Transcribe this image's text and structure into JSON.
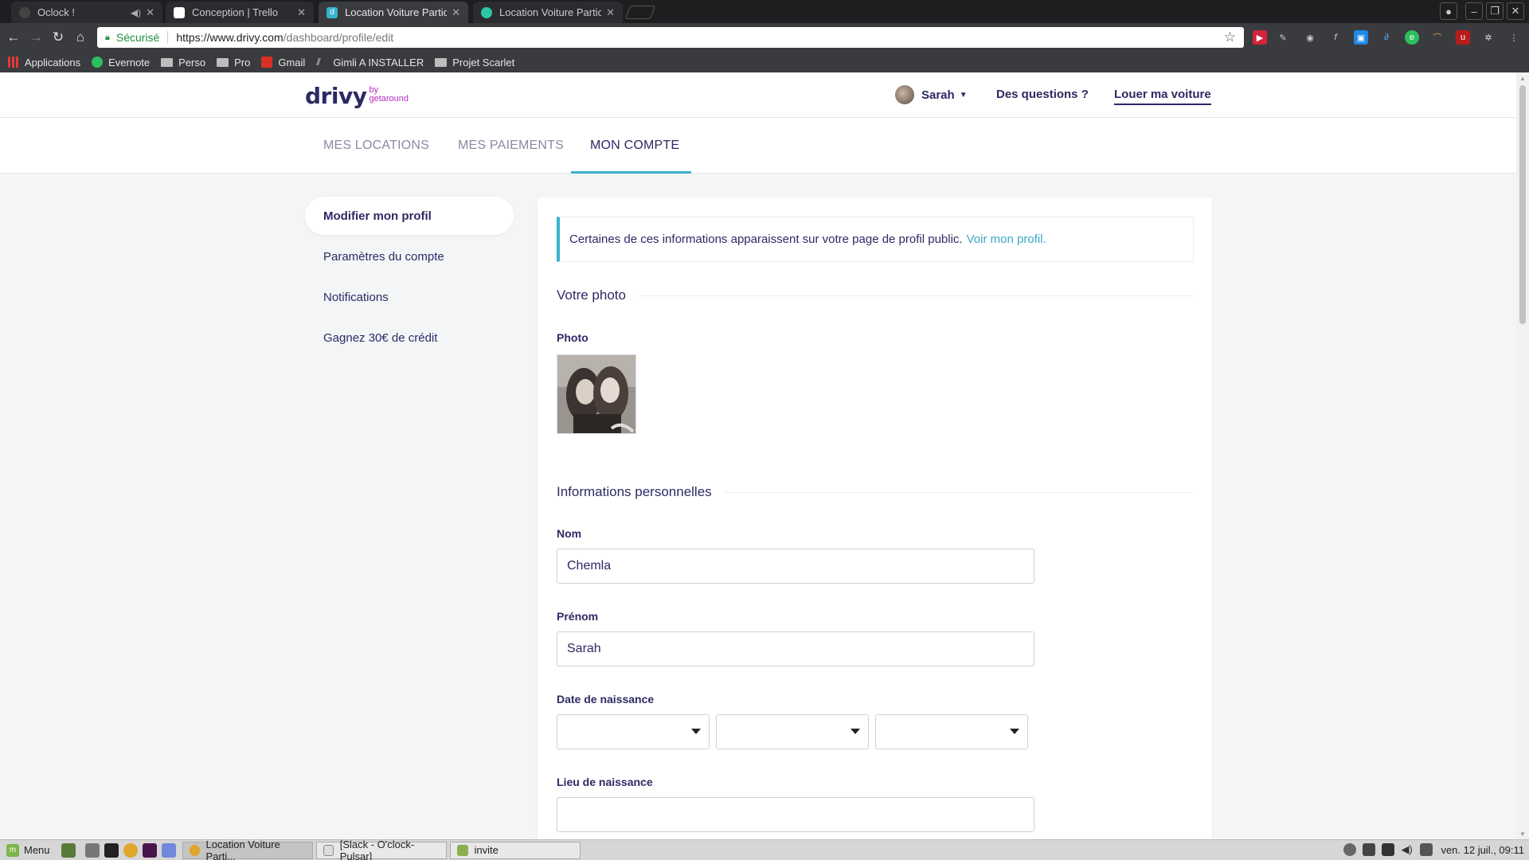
{
  "browser": {
    "tabs": [
      {
        "title": "Oclock !",
        "favicon_color": "#444444",
        "muted_icon": "speaker-icon"
      },
      {
        "title": "Conception | Trello",
        "favicon_color": "#ffffff"
      },
      {
        "title": "Location Voiture Particu",
        "favicon_color": "#38b4cf"
      },
      {
        "title": "Location Voiture Particu",
        "favicon_color": "#2ec4a6"
      }
    ],
    "omnibox": {
      "security_label": "Sécurisé",
      "url_host": "https://www.drivy.com",
      "url_path": "/dashboard/profile/edit"
    },
    "bookmarks": [
      {
        "label": "Applications",
        "icon": "apps-grid-icon"
      },
      {
        "label": "Evernote",
        "icon": "evernote-icon"
      },
      {
        "label": "Perso",
        "icon": "folder-icon"
      },
      {
        "label": "Pro",
        "icon": "folder-icon"
      },
      {
        "label": "Gmail",
        "icon": "gmail-icon"
      },
      {
        "label": "Gimli A INSTALLER",
        "icon": "gimli-icon"
      },
      {
        "label": "Projet Scarlet",
        "icon": "folder-icon"
      }
    ]
  },
  "site": {
    "logo": {
      "word": "drivy",
      "by": "by",
      "brand": "getaround"
    },
    "user_name": "Sarah",
    "help_link": "Des questions ?",
    "rent_link": "Louer ma voiture",
    "nav": [
      "MES LOCATIONS",
      "MES PAIEMENTS",
      "MON COMPTE"
    ],
    "active_nav": "MON COMPTE"
  },
  "sidebar": {
    "items": [
      {
        "label": "Modifier mon profil",
        "active": true
      },
      {
        "label": "Paramètres du compte",
        "active": false
      },
      {
        "label": "Notifications",
        "active": false
      },
      {
        "label": "Gagnez 30€ de crédit",
        "active": false
      }
    ]
  },
  "form": {
    "notice_text": "Certaines de ces informations apparaissent sur votre page de profil public.",
    "notice_link": "Voir mon profil.",
    "section_photo": "Votre photo",
    "photo_label": "Photo",
    "section_personal": "Informations personnelles",
    "nom_label": "Nom",
    "nom_value": "Chemla",
    "prenom_label": "Prénom",
    "prenom_value": "Sarah",
    "birthdate_label": "Date de naissance",
    "birthplace_label": "Lieu de naissance",
    "birthplace_value": ""
  },
  "taskbar": {
    "menu_label": "Menu",
    "windows": [
      {
        "label": "Location Voiture Parti...",
        "active": true
      },
      {
        "label": "[Slack - O'clock-Pulsar]",
        "active": false
      },
      {
        "label": "invite",
        "active": false
      }
    ],
    "clock": "ven. 12 juil., 09:11"
  },
  "colors": {
    "brand": "#2d2a64",
    "accent": "#38b4cf",
    "link": "#38a8c9",
    "by_brand": "#b32fc2"
  }
}
